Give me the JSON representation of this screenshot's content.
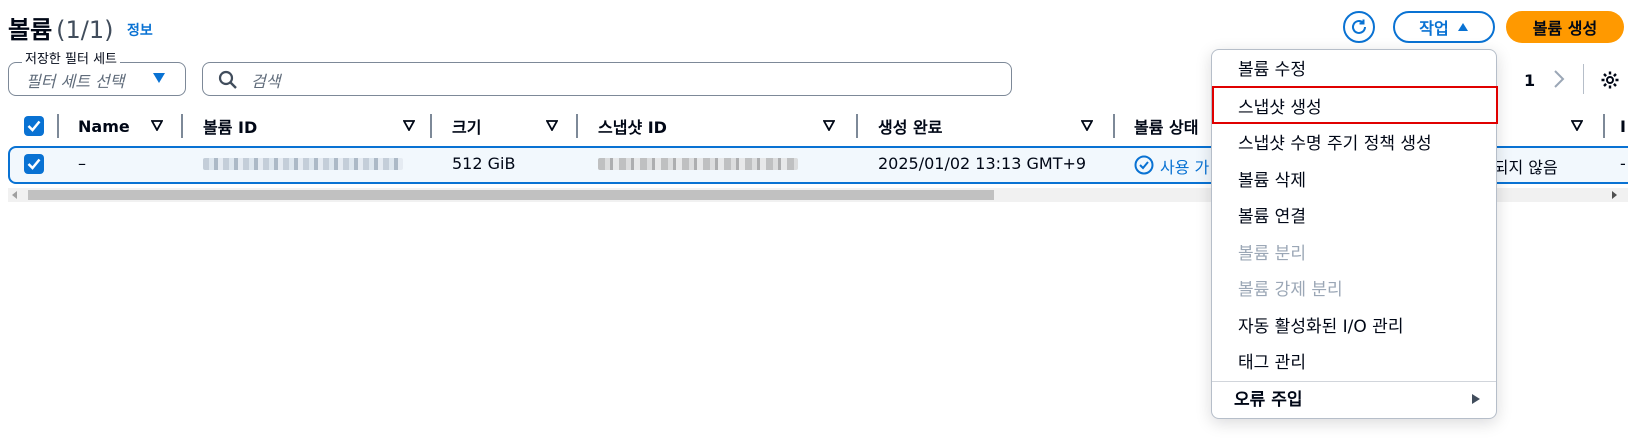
{
  "header": {
    "title": "볼륨",
    "count": "(1/1)",
    "info_link": "정보",
    "actions_label": "작업",
    "create_label": "볼륨 생성"
  },
  "filters": {
    "saved_label": "저장한 필터 세트",
    "saved_placeholder": "필터 세트 선택",
    "search_placeholder": "검색"
  },
  "pagination": {
    "page": "1"
  },
  "table": {
    "columns": [
      "Name",
      "볼륨 ID",
      "크기",
      "스냅샷 ID",
      "생성 완료",
      "볼륨 상태"
    ],
    "rows": [
      {
        "name": "–",
        "size": "512 GiB",
        "created": "2025/01/02 13:13 GMT+9",
        "status": "사용 가",
        "encryption": "-되지 않음",
        "last": "-"
      }
    ],
    "trailing_header": "I"
  },
  "menu": {
    "items": [
      {
        "label": "볼륨 수정",
        "disabled": false
      },
      {
        "label": "스냅샷 생성",
        "disabled": false,
        "highlighted": true
      },
      {
        "label": "스냅샷 수명 주기 정책 생성",
        "disabled": false
      },
      {
        "label": "볼륨 삭제",
        "disabled": false
      },
      {
        "label": "볼륨 연결",
        "disabled": false
      },
      {
        "label": "볼륨 분리",
        "disabled": true
      },
      {
        "label": "볼륨 강제 분리",
        "disabled": true
      },
      {
        "label": "자동 활성화된 I/O 관리",
        "disabled": false
      },
      {
        "label": "태그 관리",
        "disabled": false
      }
    ],
    "submenu": "오류 주입"
  },
  "colors": {
    "accent": "#0972d3",
    "primary": "#ff9900",
    "highlight": "#e00000"
  },
  "icons": [
    "refresh-icon",
    "caret-up-icon",
    "caret-down-icon",
    "search-icon",
    "chevron-right-icon",
    "gear-icon",
    "check-icon",
    "sort-icon",
    "status-ok-icon",
    "submenu-arrow-icon"
  ]
}
